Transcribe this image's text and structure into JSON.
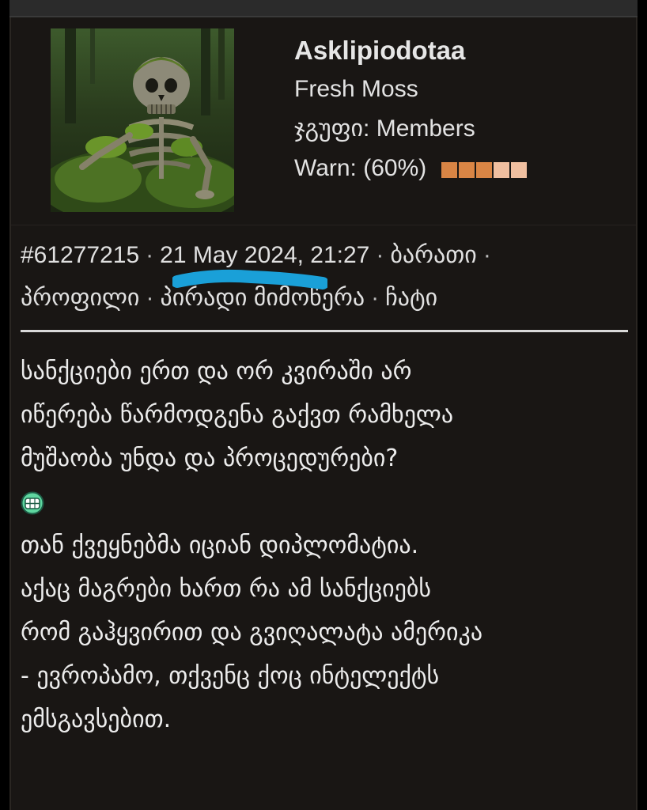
{
  "user": {
    "name": "Asklipiodotaa",
    "title": "Fresh Moss",
    "group_label": "ჯგუფი:",
    "group_value": "Members",
    "warn_label": "Warn: (60%)",
    "warn_level_percent": 60,
    "warn_colors": [
      "#d98545",
      "#d98545",
      "#d98545",
      "#f0bfa0",
      "#f0bfa0"
    ]
  },
  "post": {
    "id": "#61277215",
    "date": "21 May 2024, 21:27",
    "links": {
      "card": "ბარათი",
      "profile": "პროფილი",
      "private_message": "პირადი მიმოწერა",
      "chat": "ჩატი"
    },
    "body_lines": [
      "სანქციები ერთ და ორ კვირაში არ",
      "იწერება წარმოდგენა გაქვთ რამხელა",
      "მუშაობა უნდა და პროცედურები?",
      "თან ქვეყნებმა იციან დიპლომატია.",
      "აქაც მაგრები ხართ რა ამ სანქციებს",
      "რომ გაჰყვირით და გვიღალატა ამერიკა",
      "- ევროპამო, თქვენც ქოც ინტელექტს",
      "ემსგავსებით."
    ],
    "emoji_name": "laughing-smiley-icon"
  },
  "colors": {
    "highlight": "#1aa0d8",
    "accent_text": "#e4e4e4",
    "background": "#191614"
  }
}
